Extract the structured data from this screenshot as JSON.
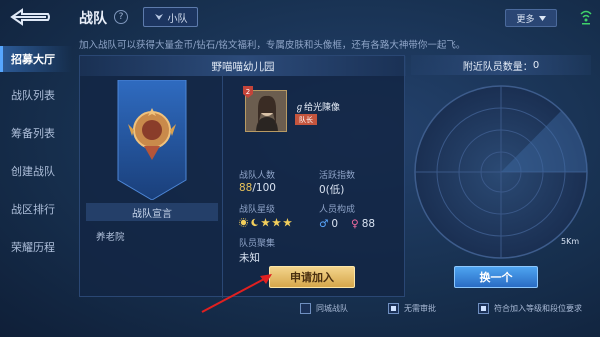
{
  "header": {
    "title": "战队",
    "squad_label": "小队",
    "more_label": "更多"
  },
  "sidebar": {
    "items": [
      {
        "label": "招募大厅",
        "active": true
      },
      {
        "label": "战队列表",
        "active": false
      },
      {
        "label": "筹备列表",
        "active": false
      },
      {
        "label": "创建战队",
        "active": false
      },
      {
        "label": "战区排行",
        "active": false
      },
      {
        "label": "荣耀历程",
        "active": false
      }
    ]
  },
  "notice": "加入战队可以获得大量金币/钻石/铭文福利，专属皮肤和头像框，还有各路大神带你一起飞。",
  "team": {
    "name": "野喵喵幼儿园",
    "declaration_title": "战队宣言",
    "declaration": "养老院",
    "leader_name": "ℊ给光陳像",
    "leader_tag": "队长",
    "rank_badge": "2",
    "members_label": "战队人数",
    "members_current": "88",
    "members_max": "/100",
    "activity_label": "活跃指数",
    "activity_value": "0(低)",
    "star_label": "战队星级",
    "composition_label": "人员构成",
    "male_count": "0",
    "female_count": "88",
    "gathering_label": "队员聚集",
    "gathering_value": "未知",
    "apply_label": "申请加入"
  },
  "radar": {
    "title": "附近队员数量：",
    "count": "0",
    "range_label": "5Km",
    "switch_label": "换一个"
  },
  "filters": [
    {
      "label": "同城战队",
      "checked": false
    },
    {
      "label": "无需审批",
      "checked": true
    },
    {
      "label": "符合加入等级和段位要求",
      "checked": true
    }
  ],
  "colors": {
    "accent_gold": "#e8c25a",
    "apply_button": "#d6a74b",
    "switch_button": "#2a6cc4",
    "annotation_arrow": "#e02020"
  }
}
